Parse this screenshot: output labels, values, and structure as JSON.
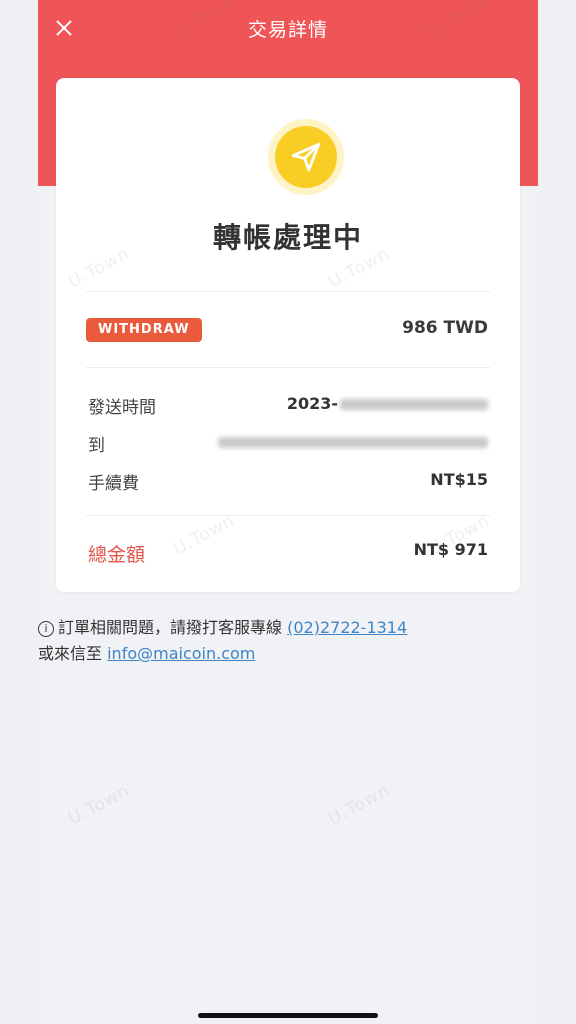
{
  "header": {
    "title": "交易詳情"
  },
  "status": {
    "title": "轉帳處理中"
  },
  "transaction": {
    "type_badge": "WITHDRAW",
    "amount": "986 TWD",
    "rows": [
      {
        "label": "發送時間",
        "value": "2023-"
      },
      {
        "label": "到",
        "value": ""
      },
      {
        "label": "手續費",
        "value": "NT$15"
      }
    ],
    "total_label": "總金額",
    "total_value": "NT$ 971"
  },
  "notice": {
    "text": "訂單相關問題，請撥打客服專線",
    "phone": "(02)2722-1314",
    "text2": "或來信至",
    "email": "info@maicoin.com"
  },
  "watermark": "U.Town",
  "colors": {
    "header": "#ef5557",
    "badge": "#ea5b3e",
    "total_label": "#e2574c",
    "link": "#3f84c6",
    "status_icon": "#f9cd24"
  },
  "icons": {
    "close": "close-icon",
    "status": "paper-plane-icon",
    "info": "info-icon"
  }
}
